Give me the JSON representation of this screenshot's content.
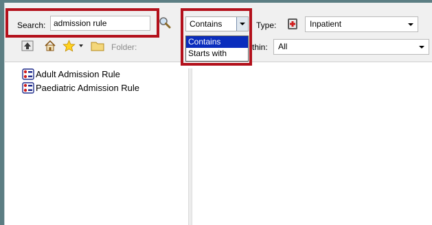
{
  "search": {
    "label": "Search:",
    "value": "admission rule"
  },
  "match_filter": {
    "selected": "Contains",
    "options": [
      "Contains",
      "Starts with"
    ]
  },
  "type_filter": {
    "label": "Type:",
    "selected": "Inpatient"
  },
  "within_filter": {
    "label": "thin:",
    "selected": "All"
  },
  "toolbar": {
    "folder_label": "Folder:"
  },
  "results": [
    {
      "label": "Adult Admission Rule"
    },
    {
      "label": "Paediatric Admission Rule"
    }
  ],
  "colors": {
    "highlight_box": "#b3101b",
    "selection": "#0a2dbd"
  },
  "icons": {
    "search": "magnifier-icon",
    "type": "inpatient-bed-icon",
    "up": "up-folder-icon",
    "home": "home-icon",
    "favorites": "star-icon",
    "folder": "folder-icon",
    "rule": "rule-icon"
  }
}
